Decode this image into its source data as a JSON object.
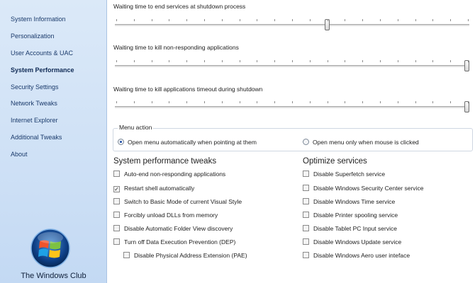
{
  "nav": {
    "items": [
      {
        "label": "System Information"
      },
      {
        "label": "Personalization"
      },
      {
        "label": "User Accounts & UAC"
      },
      {
        "label": "System Performance",
        "active": true
      },
      {
        "label": "Security Settings"
      },
      {
        "label": "Network Tweaks"
      },
      {
        "label": "Internet Explorer"
      },
      {
        "label": "Additional Tweaks"
      },
      {
        "label": "About"
      }
    ],
    "brand": "The Windows Club"
  },
  "sliders": [
    {
      "label": "Waiting time to end services at shutdown process",
      "value_fraction": 0.6
    },
    {
      "label": "Waiting time to kill non-responding applications",
      "value_fraction": 1.0
    },
    {
      "label": "Waiting time to kill applications timeout during shutdown",
      "value_fraction": 1.0
    }
  ],
  "menu_action": {
    "title": "Menu action",
    "options": [
      {
        "label": "Open menu automatically when pointing at them",
        "selected": true
      },
      {
        "label": "Open menu only when mouse is clicked",
        "selected": false
      }
    ]
  },
  "tweaks": {
    "title": "System performance tweaks",
    "items": [
      {
        "label": "Auto-end non-responding applications",
        "checked": false
      },
      {
        "label": "Restart shell automatically",
        "checked": true
      },
      {
        "label": "Switch to Basic Mode of current Visual Style",
        "checked": false
      },
      {
        "label": "Forcibly unload DLLs from memory",
        "checked": false
      },
      {
        "label": "Disable Automatic Folder View discovery",
        "checked": false
      },
      {
        "label": "Turn off Data Execution Prevention (DEP)",
        "checked": false
      },
      {
        "label": "Disable Physical Address Extension (PAE)",
        "checked": false
      }
    ]
  },
  "services": {
    "title": "Optimize services",
    "items": [
      {
        "label": "Disable Superfetch service",
        "checked": false
      },
      {
        "label": "Disable Windows Security Center service",
        "checked": false
      },
      {
        "label": "Disable Windows Time service",
        "checked": false
      },
      {
        "label": "Disable Printer spooling service",
        "checked": false
      },
      {
        "label": "Disable Tablet PC Input service",
        "checked": false
      },
      {
        "label": "Disable Windows Update service",
        "checked": false
      },
      {
        "label": "Disable Windows Aero user inteface",
        "checked": false
      }
    ]
  }
}
